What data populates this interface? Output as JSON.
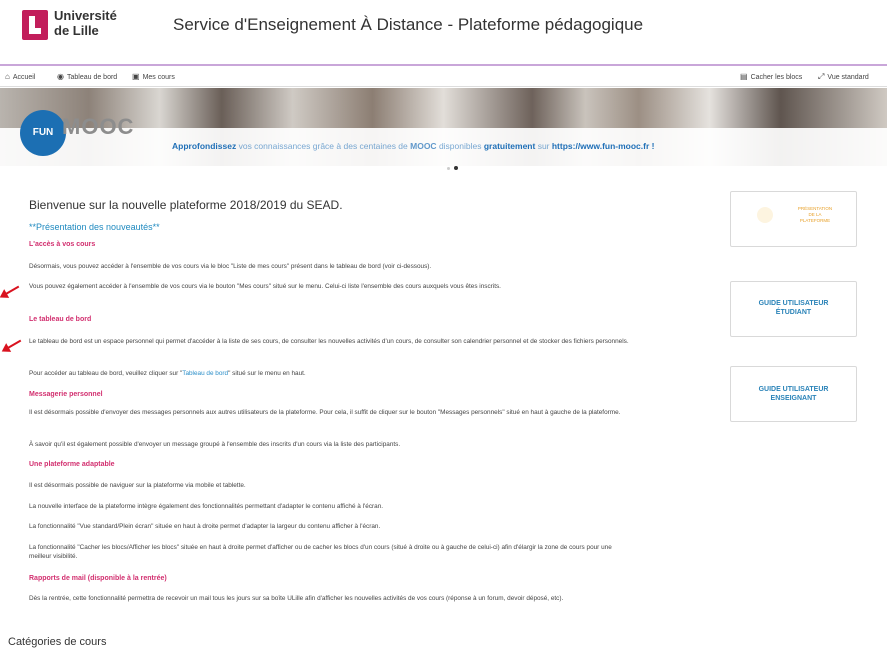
{
  "header": {
    "logo_line1": "Université",
    "logo_line2": "de Lille",
    "site_title": "Service d'Enseignement À Distance - Plateforme pédagogique"
  },
  "nav": {
    "home": "Accueil",
    "dashboard": "Tableau de bord",
    "my_courses": "Mes cours",
    "hide_blocks": "Cacher les blocs",
    "standard_view": "Vue standard"
  },
  "banner": {
    "fun": "FUN",
    "mooc": "MOOC",
    "text_a": "Approfondissez",
    "text_b": " vos connaissances grâce à des centaines de ",
    "text_c": "MOOC",
    "text_d": " disponibles ",
    "text_e": "gratuitement",
    "text_f": " sur ",
    "text_g": "https://www.fun-mooc.fr !"
  },
  "main": {
    "welcome": "Bienvenue sur la nouvelle plateforme 2018/2019 du SEAD.",
    "presentation": "**Présentation des nouveautés**",
    "s1_title": "L'accès à vos cours",
    "s1_p1": "Désormais, vous pouvez accéder à l'ensemble de vos cours via le bloc \"Liste de mes cours\" présent dans le tableau de bord (voir ci-dessous).",
    "s1_p2": "Vous pouvez également accéder à l'ensemble de vos cours via le bouton \"Mes cours\" situé sur le menu. Celui-ci liste l'ensemble des cours auxquels vous êtes inscrits.",
    "s2_title": "Le tableau de bord",
    "s2_p1": "Le tableau de bord est un espace personnel qui permet d'accéder à la liste de ses cours, de consulter les nouvelles activités d'un cours, de consulter son calendrier personnel et de stocker des fichiers personnels.",
    "s2_p2a": "Pour accéder au tableau de bord, veuillez cliquer sur \"",
    "s2_p2_link": "Tableau de bord",
    "s2_p2b": "\" situé sur le menu en haut.",
    "s3_title": "Messagerie personnel",
    "s3_p1": "Il est désormais possible d'envoyer des messages personnels aux autres utilisateurs de la plateforme. Pour cela, il suffit de cliquer sur le bouton \"Messages personnels\" situé en haut à gauche de la plateforme.",
    "s3_p2": "À savoir qu'il est également possible d'envoyer un message groupé à l'ensemble des inscrits d'un cours via la liste des participants.",
    "s4_title": "Une plateforme adaptable",
    "s4_p1": "Il est désormais possible de naviguer sur la plateforme via mobile et tablette.",
    "s4_p2": "La nouvelle interface de la plateforme intègre également des fonctionnalités permettant d'adapter le contenu affiché à l'écran.",
    "s4_p3": "La fonctionnalité \"Vue standard/Plein écran\" située en haut à droite permet d'adapter la largeur du contenu afficher à l'écran.",
    "s4_p4": "La fonctionnalité \"Cacher les blocs/Afficher les blocs\" située en haut à droite permet d'afficher ou de cacher les blocs d'un cours (situé à droite ou à gauche de celui-ci) afin d'élargir la zone de cours pour une meilleur visibilité.",
    "s5_title": "Rapports de mail (disponible à la rentrée)",
    "s5_p1": "Dès la rentrée, cette fonctionnalité permettra de recevoir un mail tous les jours sur sa boîte ULille afin d'afficher les nouvelles activités de vos cours (réponse à un forum, devoir déposé, etc).",
    "categories": "Catégories de cours"
  },
  "side": {
    "pres_l1": "PRÉSENTATION",
    "pres_l2": "DE LA",
    "pres_l3": "PLATEFORME",
    "student_l1": "GUIDE UTILISATEUR",
    "student_l2": "ÉTUDIANT",
    "teacher_l1": "GUIDE UTILISATEUR",
    "teacher_l2": "ENSEIGNANT"
  },
  "colors": {
    "brand": "#c21e5b",
    "link": "#2a8ec8",
    "section": "#d22f6f",
    "annotation": "#d9121f"
  },
  "icons": [
    "home-icon",
    "dashboard-icon",
    "courses-icon",
    "hide-blocks-icon",
    "fullscreen-icon"
  ]
}
